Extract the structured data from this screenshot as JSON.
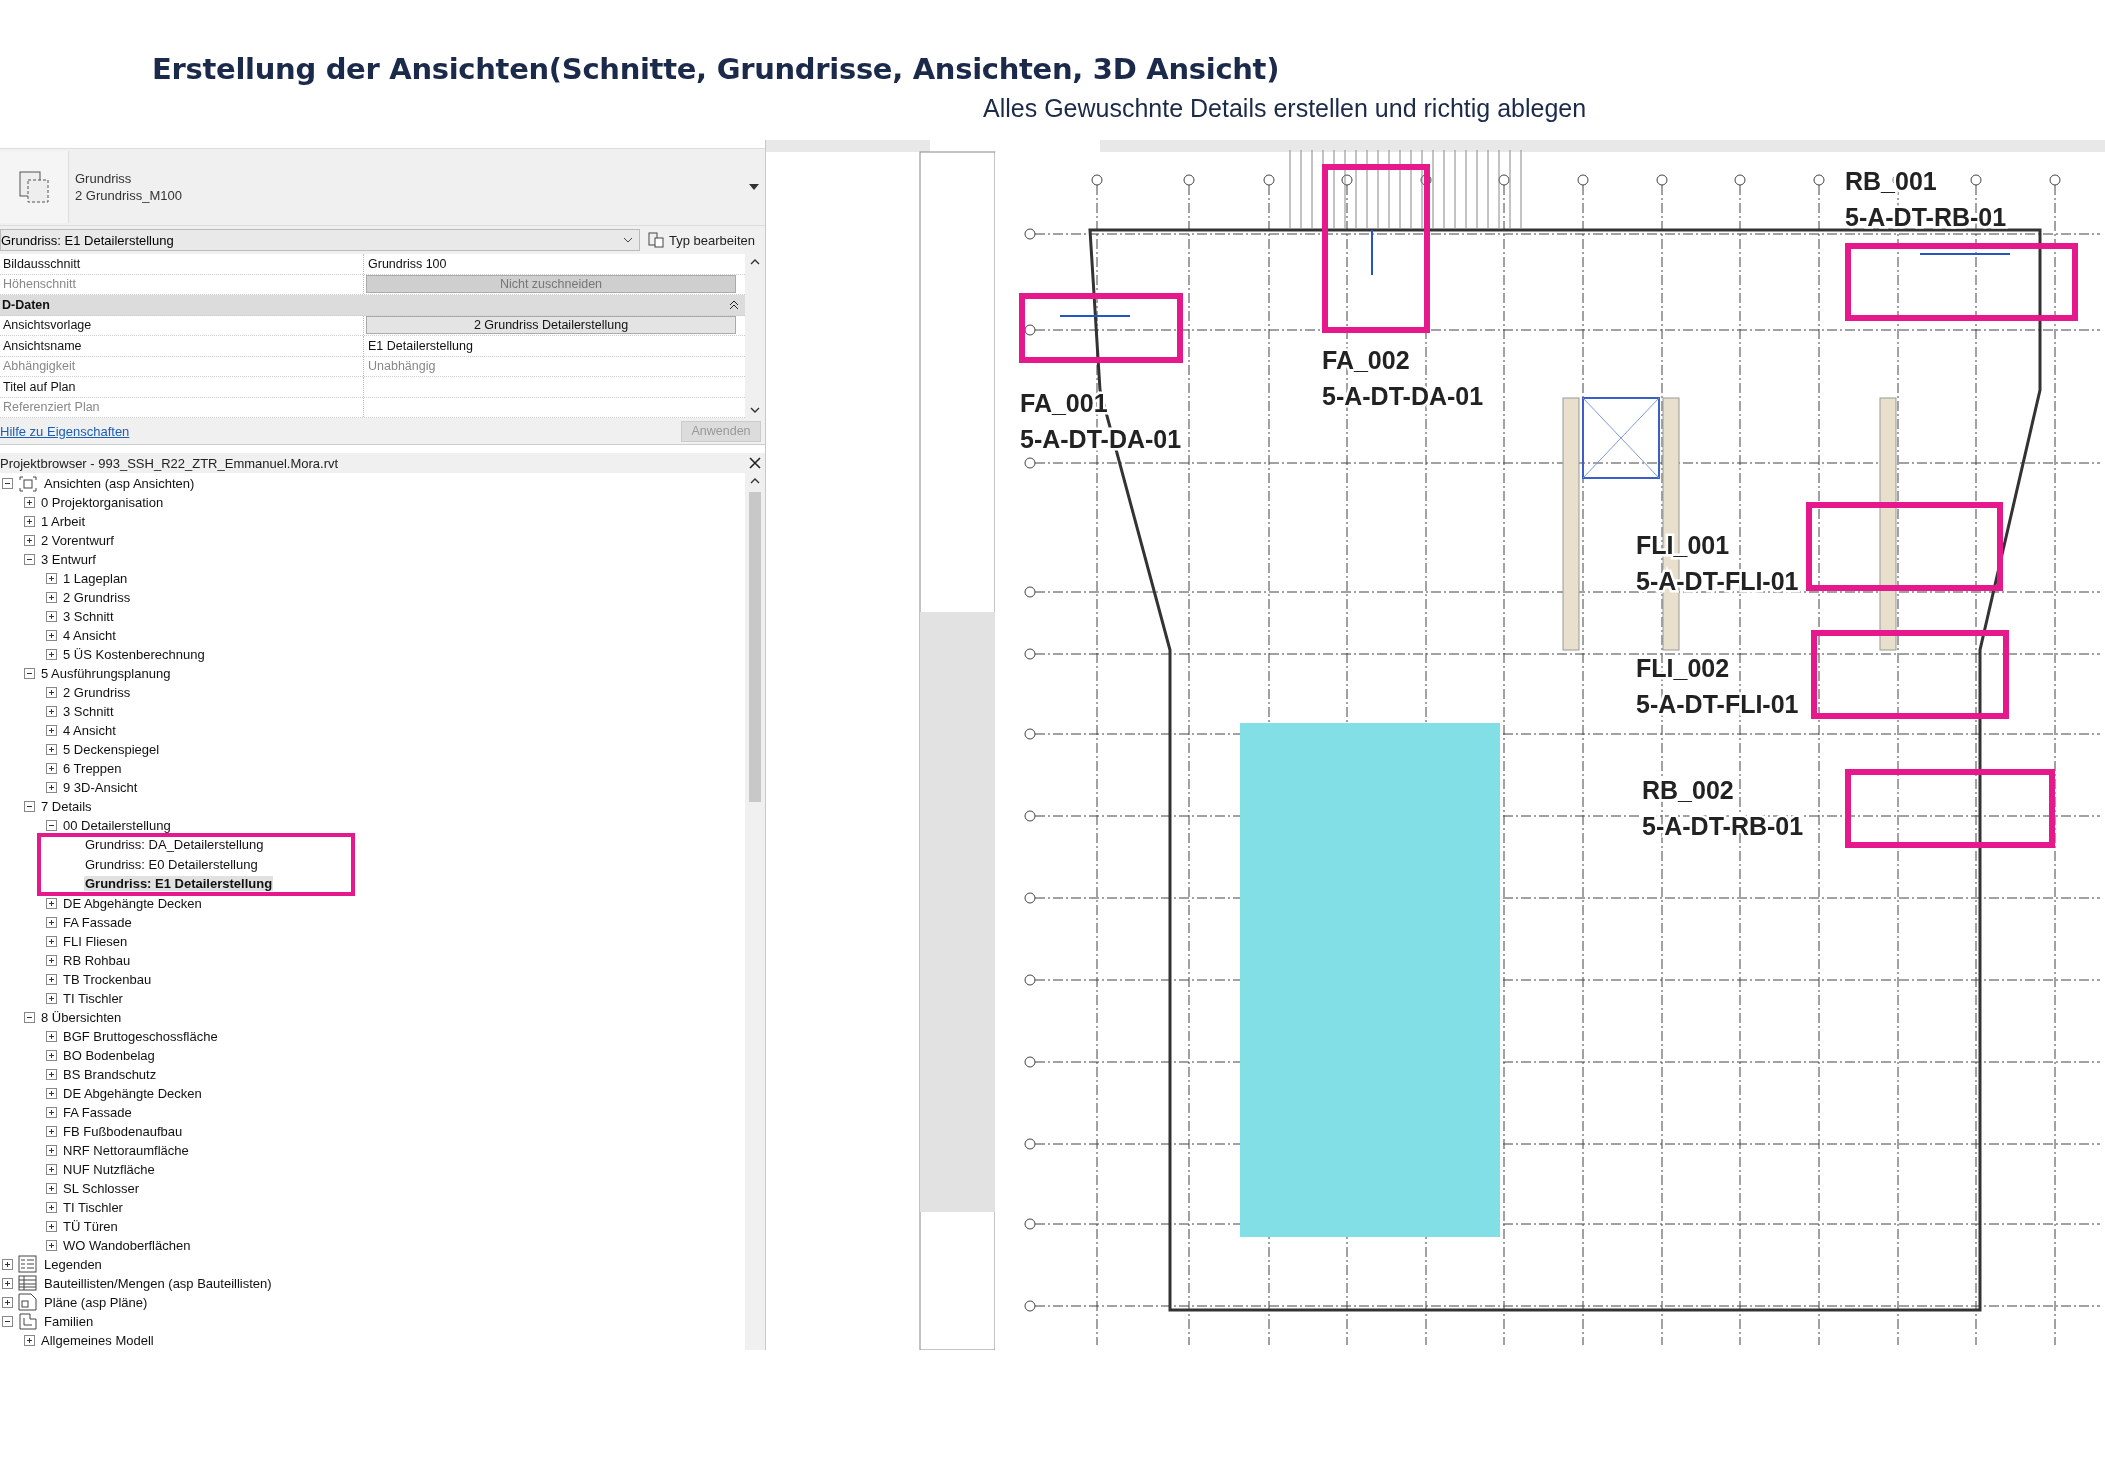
{
  "title": "Erstellung der Ansichten(Schnitte, Grundrisse, Ansichten, 3D Ansicht)",
  "subtitle": "Alles Gewuschnte Details erstellen und richtig ablegen",
  "properties": {
    "type_selector": {
      "category": "Grundriss",
      "type": "2 Grundriss_M100"
    },
    "instance_dropdown": "Grundriss: E1 Detailerstellung",
    "edit_type_button": "Typ bearbeiten",
    "rows": [
      {
        "kind": "property",
        "label": "Bildausschnitt",
        "value": "Grundriss 100",
        "disabled": false,
        "button": false
      },
      {
        "kind": "property",
        "label": "Höhenschnitt",
        "value": "Nicht zuschneiden",
        "disabled": true,
        "button": true
      },
      {
        "kind": "section",
        "label": "D-Daten",
        "expanded": true
      },
      {
        "kind": "property",
        "label": "Ansichtsvorlage",
        "value": "2 Grundriss Detailerstellung",
        "disabled": false,
        "button": true
      },
      {
        "kind": "property",
        "label": "Ansichtsname",
        "value": "E1 Detailerstellung",
        "disabled": false,
        "button": false
      },
      {
        "kind": "property",
        "label": "Abhängigkeit",
        "value": "Unabhängig",
        "disabled": true,
        "button": false
      },
      {
        "kind": "property",
        "label": "Titel auf Plan",
        "disabled": false
      },
      {
        "kind": "property",
        "label": "Referenziert Plan",
        "disabled": true
      }
    ],
    "help_link": "Hilfe zu Eigenschaften",
    "apply_button": {
      "label": "Anwenden",
      "disabled": true
    }
  },
  "project_browser": {
    "title": "Projektbrowser - 993_SSH_R22_ZTR_Emmanuel.Mora.rvt",
    "tree": [
      {
        "label": "Ansichten (asp Ansichten)",
        "kind": "views",
        "expanded": true,
        "children": [
          {
            "label": "0 Projektorganisation",
            "expanded": false
          },
          {
            "label": "1 Arbeit",
            "expanded": false
          },
          {
            "label": "2 Vorentwurf",
            "expanded": false
          },
          {
            "label": "3 Entwurf",
            "expanded": true,
            "children": [
              {
                "label": "1 Lageplan",
                "expanded": false
              },
              {
                "label": "2 Grundriss",
                "expanded": false
              },
              {
                "label": "3 Schnitt",
                "expanded": false
              },
              {
                "label": "4 Ansicht",
                "expanded": false
              },
              {
                "label": "5 ÜS Kostenberechnung",
                "expanded": false
              }
            ]
          },
          {
            "label": "5 Ausführungsplanung",
            "expanded": true,
            "children": [
              {
                "label": "2 Grundriss",
                "expanded": false
              },
              {
                "label": "3 Schnitt",
                "expanded": false
              },
              {
                "label": "4 Ansicht",
                "expanded": false
              },
              {
                "label": "5 Deckenspiegel",
                "expanded": false
              },
              {
                "label": "6 Treppen",
                "expanded": false
              },
              {
                "label": "9 3D-Ansicht",
                "expanded": false
              }
            ]
          },
          {
            "label": "7 Details",
            "expanded": true,
            "children": [
              {
                "label": "00 Detailerstellung",
                "expanded": true,
                "children": [
                  {
                    "label": "Grundriss: DA_Detailerstellung",
                    "selected": false
                  },
                  {
                    "label": "Grundriss: E0 Detailerstellung",
                    "selected": false
                  },
                  {
                    "label": "Grundriss: E1 Detailerstellung",
                    "selected": true
                  }
                ]
              },
              {
                "label": "DE Abgehängte Decken",
                "expanded": false
              },
              {
                "label": "FA Fassade",
                "expanded": false
              },
              {
                "label": "FLI Fliesen",
                "expanded": false
              },
              {
                "label": "RB Rohbau",
                "expanded": false
              },
              {
                "label": "TB Trockenbau",
                "expanded": false
              },
              {
                "label": "TI Tischler",
                "expanded": false
              }
            ]
          },
          {
            "label": "8 Übersichten",
            "expanded": true,
            "children": [
              {
                "label": "BGF Bruttogeschossfläche",
                "expanded": false
              },
              {
                "label": "BO Bodenbelag",
                "expanded": false
              },
              {
                "label": "BS Brandschutz",
                "expanded": false
              },
              {
                "label": "DE Abgehängte Decken",
                "expanded": false
              },
              {
                "label": "FA Fassade",
                "expanded": false
              },
              {
                "label": "FB Fußbodenaufbau",
                "expanded": false
              },
              {
                "label": "NRF Nettoraumfläche",
                "expanded": false
              },
              {
                "label": "NUF Nutzfläche",
                "expanded": false
              },
              {
                "label": "SL Schlosser",
                "expanded": false
              },
              {
                "label": "TI Tischler",
                "expanded": false
              },
              {
                "label": "TÜ Türen",
                "expanded": false
              },
              {
                "label": "WO Wandoberflächen",
                "expanded": false
              }
            ]
          }
        ]
      },
      {
        "label": "Legenden",
        "kind": "legend",
        "expanded": false
      },
      {
        "label": "Bauteillisten/Mengen (asp Bauteillisten)",
        "kind": "schedule",
        "expanded": false
      },
      {
        "label": "Pläne (asp Pläne)",
        "kind": "sheet",
        "expanded": false
      },
      {
        "label": "Familien",
        "kind": "family",
        "expanded": true,
        "children": [
          {
            "label": "Allgemeines Modell",
            "expanded": false
          }
        ]
      }
    ]
  },
  "callouts": [
    {
      "name": "FA_001",
      "code": "5-A-DT-DA-01"
    },
    {
      "name": "FA_002",
      "code": "5-A-DT-DA-01"
    },
    {
      "name": "RB_001",
      "code": "5-A-DT-RB-01"
    },
    {
      "name": "FLI_001",
      "code": "5-A-DT-FLI-01"
    },
    {
      "name": "FLI_002",
      "code": "5-A-DT-FLI-01"
    },
    {
      "name": "RB_002",
      "code": "5-A-DT-RB-01"
    }
  ]
}
